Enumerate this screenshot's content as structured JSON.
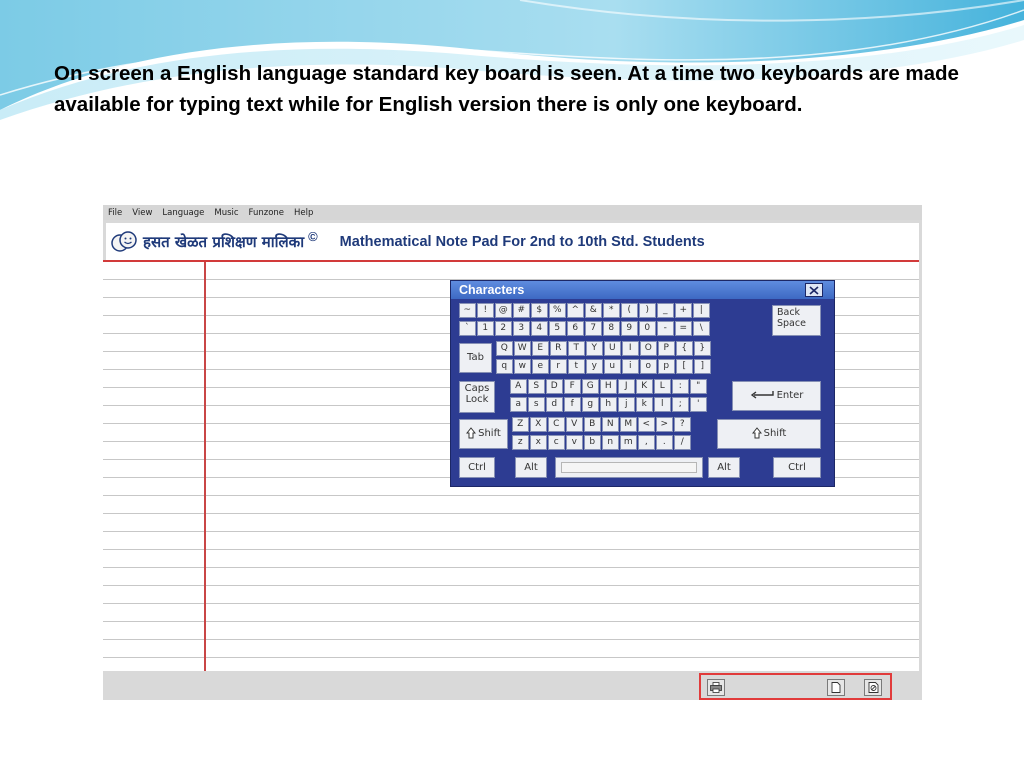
{
  "slide": {
    "text": "On screen a English language standard key board is seen. At a time two keyboards are made available for typing text while for English version there is only one keyboard."
  },
  "app": {
    "menu": [
      "File",
      "View",
      "Language",
      "Music",
      "Funzone",
      "Help"
    ],
    "header": {
      "marathi_title": "हसत खेळत प्रशिक्षण मालिका",
      "copyright": "©",
      "title": "Mathematical Note Pad For 2nd  to 10th Std. Students"
    },
    "status_buttons": [
      "print-icon",
      "new-page-icon",
      "clear-icon"
    ]
  },
  "character_window": {
    "title": "Characters",
    "rows": [
      [
        "~",
        "!",
        "@",
        "#",
        "$",
        "%",
        "^",
        "&",
        "*",
        "(",
        ")",
        "_",
        "+",
        "|"
      ],
      [
        "`",
        "1",
        "2",
        "3",
        "4",
        "5",
        "6",
        "7",
        "8",
        "9",
        "0",
        "-",
        "=",
        "\\"
      ],
      [
        "Q",
        "W",
        "E",
        "R",
        "T",
        "Y",
        "U",
        "I",
        "O",
        "P",
        "{",
        "}"
      ],
      [
        "q",
        "w",
        "e",
        "r",
        "t",
        "y",
        "u",
        "i",
        "o",
        "p",
        "[",
        "]"
      ],
      [
        "A",
        "S",
        "D",
        "F",
        "G",
        "H",
        "J",
        "K",
        "L",
        ":",
        "\""
      ],
      [
        "a",
        "s",
        "d",
        "f",
        "g",
        "h",
        "j",
        "k",
        "l",
        ";",
        "'"
      ],
      [
        "Z",
        "X",
        "C",
        "V",
        "B",
        "N",
        "M",
        "<",
        ">",
        "?"
      ],
      [
        "z",
        "x",
        "c",
        "v",
        "b",
        "n",
        "m",
        ",",
        ".",
        "/"
      ]
    ],
    "labels": {
      "backspace": "Back Space",
      "tab": "Tab",
      "capslock": "Caps Lock",
      "enter": "Enter",
      "shift": "Shift",
      "ctrl": "Ctrl",
      "alt": "Alt"
    }
  }
}
